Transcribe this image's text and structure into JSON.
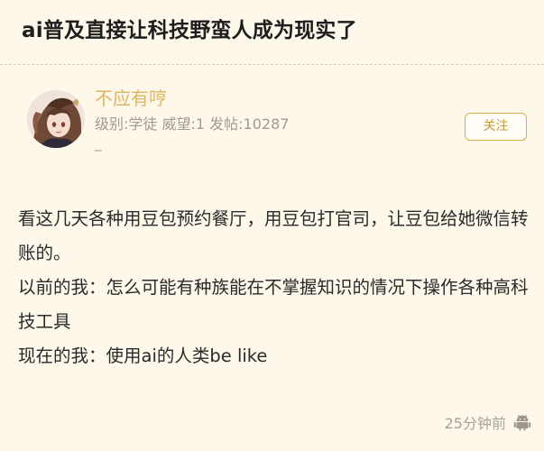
{
  "post": {
    "title": "ai普及直接让科技野蛮人成为现实了"
  },
  "author": {
    "name": "不应有哼",
    "info": "级别:学徒 威望:1 发帖:10287",
    "extra": "_",
    "follow_label": "关注",
    "avatar_icon": "anime-avatar"
  },
  "content": {
    "paragraphs": [
      "看这几天各种用豆包预约餐厅，用豆包打官司，让豆包给她微信转账的。",
      "以前的我：怎么可能有种族能在不掌握知识的情况下操作各种高科技工具",
      "现在的我：使用ai的人类be like"
    ]
  },
  "footer": {
    "time": "25分钟前",
    "device_icon": "android-icon"
  },
  "colors": {
    "background": "#fdf8ea",
    "username": "#e0b461",
    "accent": "#d9ac45",
    "muted": "#a09a90"
  }
}
